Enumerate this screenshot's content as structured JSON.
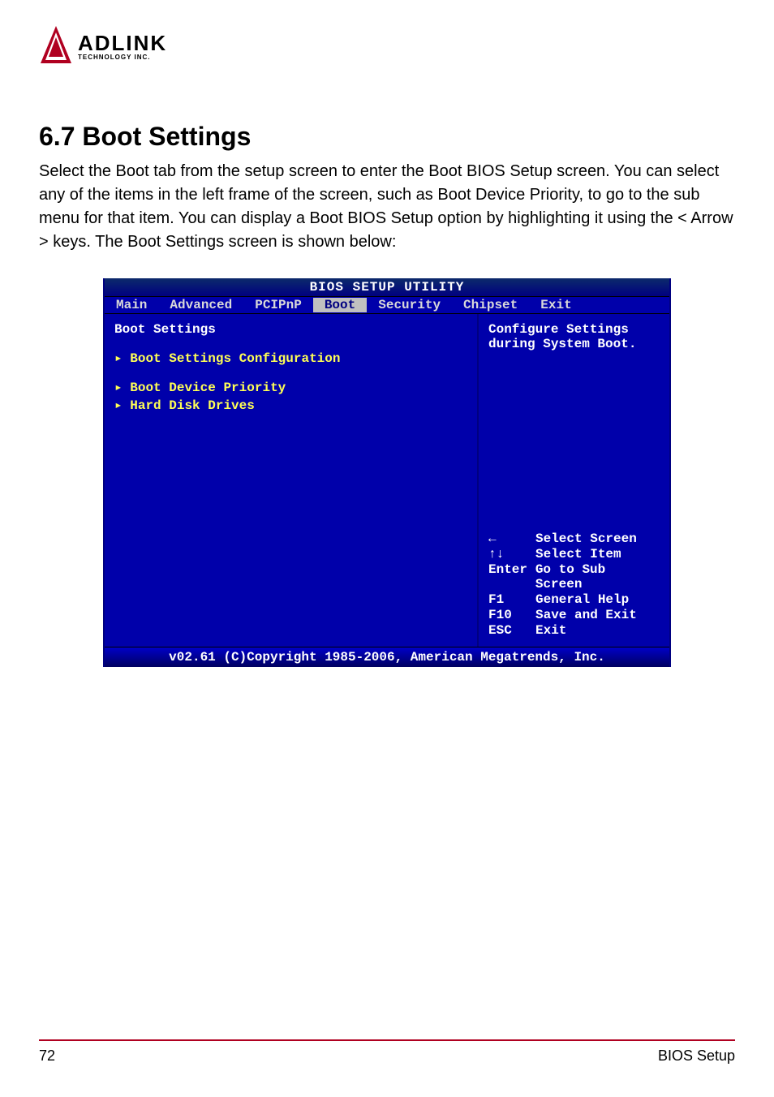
{
  "logo": {
    "name": "ADLINK",
    "sub": "TECHNOLOGY INC."
  },
  "heading": "6.7 Boot Settings",
  "paragraph": "Select the Boot tab from the setup screen to enter the Boot BIOS Setup screen. You can select any of the items in the left frame of the screen, such as Boot Device Priority, to go to the sub menu for that item. You can display a Boot BIOS Setup option by highlighting it using the < Arrow > keys. The Boot Settings screen is shown below:",
  "bios": {
    "title": "BIOS SETUP UTILITY",
    "tabs": [
      "Main",
      "Advanced",
      "PCIPnP",
      "Boot",
      "Security",
      "Chipset",
      "Exit"
    ],
    "selected_tab": "Boot",
    "left_title": "Boot Settings",
    "submenus": [
      "Boot Settings Configuration",
      "Boot Device Priority",
      "Hard Disk Drives"
    ],
    "help": "Configure Settings during System Boot.",
    "keys": [
      {
        "k": "←",
        "d": "Select Screen"
      },
      {
        "k": "↑↓",
        "d": "Select Item"
      },
      {
        "k": "Enter",
        "d": "Go to Sub Screen"
      },
      {
        "k": "F1",
        "d": "General Help"
      },
      {
        "k": "F10",
        "d": "Save and Exit"
      },
      {
        "k": "ESC",
        "d": "Exit"
      }
    ],
    "footer": "v02.61 (C)Copyright 1985-2006, American Megatrends, Inc."
  },
  "footer": {
    "left": "72",
    "right": "BIOS Setup"
  }
}
